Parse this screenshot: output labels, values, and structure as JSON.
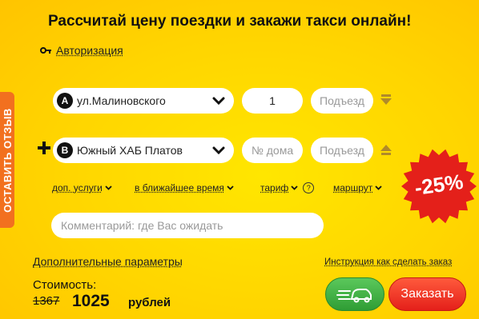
{
  "header": {
    "title": "Рассчитай цену поездки и закажи такси онлайн!"
  },
  "auth": {
    "label": "Авторизация",
    "icon": "key-icon"
  },
  "side_tab": {
    "label": "ОСТАВИТЬ ОТЗЫВ"
  },
  "route": {
    "from": {
      "marker": "A",
      "address": "ул.Малиновского",
      "house": "1",
      "entrance_placeholder": "Подъезд"
    },
    "to": {
      "marker": "B",
      "address": "Южный ХАБ Платов",
      "house_placeholder": "№ дома",
      "entrance_placeholder": "Подъезд"
    }
  },
  "options": {
    "services": "доп. услуги",
    "time": "в ближайшее время",
    "tariff": "тариф",
    "tariff_help": "?",
    "route": "маршрут"
  },
  "comment": {
    "placeholder": "Комментарий: где Вас ожидать"
  },
  "links": {
    "extra_params": "Дополнительные параметры",
    "instruction": "Инструкция как сделать заказ"
  },
  "cost": {
    "label": "Стоимость:",
    "old_price": "1367",
    "price": "1025",
    "currency": "рублей"
  },
  "buttons": {
    "order": "Заказать"
  },
  "promo": {
    "discount": "-25%"
  },
  "colors": {
    "background": "#ffd500",
    "side_tab": "#f2701f",
    "order": "#e4201a",
    "green": "#2f9d35"
  }
}
